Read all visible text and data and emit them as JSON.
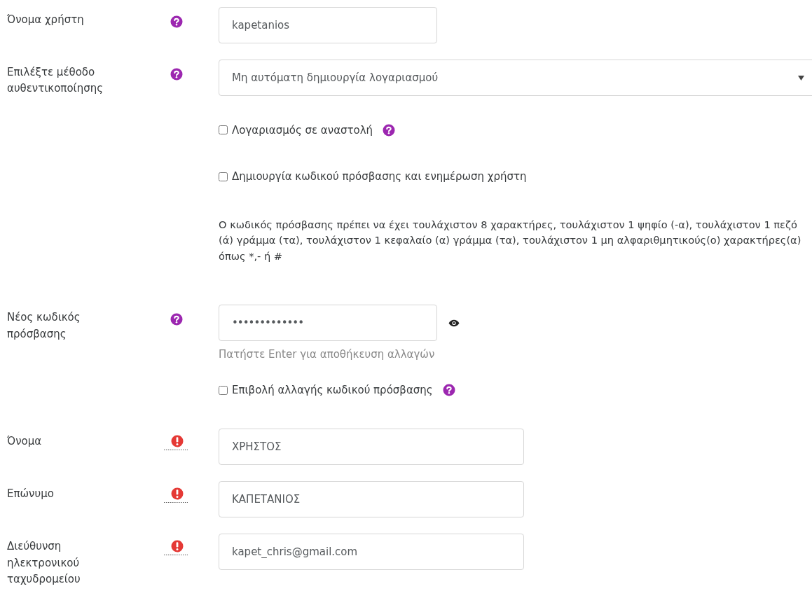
{
  "rows": [
    {
      "kind": "text",
      "label": "Όνομα χρήστη",
      "help": true,
      "required": false,
      "value": "kapetanios",
      "wide": false
    },
    {
      "kind": "select",
      "label": "Επιλέξτε μέθοδο αυθεντικοποίησης",
      "help": true,
      "required": false,
      "value": "Μη αυτόματη δημιουργία λογαριασμού"
    },
    {
      "kind": "checkbox",
      "text": "Λογαριασμός σε αναστολή",
      "checked": false,
      "help": true
    },
    {
      "kind": "checkbox",
      "text": "Δημιουργία κωδικού πρόσβασης και ενημέρωση χρήστη",
      "checked": false,
      "help": false
    },
    {
      "kind": "paragraph",
      "text": "Ο κωδικός πρόσβασης πρέπει να έχει τουλάχιστον 8 χαρακτήρες, τουλάχιστον 1 ψηφίο (-α), τουλάχιστον 1 πεζό (ά) γράμμα (τα), τουλάχιστον 1 κεφαλαίο (α) γράμμα (τα), τουλάχιστον 1 μη αλφαριθμητικούς(ο) χαρακτήρες(α) όπως *,- ή #"
    },
    {
      "kind": "password",
      "label": "Νέος κωδικός πρόσβασης",
      "help": true,
      "required": false,
      "value": "•••••••••••••",
      "hint": "Πατήστε Enter για αποθήκευση αλλαγών"
    },
    {
      "kind": "checkbox",
      "text": "Επιβολή αλλαγής κωδικού πρόσβασης",
      "checked": false,
      "help": true
    },
    {
      "kind": "text",
      "label": "Όνομα",
      "help": false,
      "required": true,
      "value": "ΧΡΗΣΤΟΣ",
      "wide": true
    },
    {
      "kind": "text",
      "label": "Επώνυμο",
      "help": false,
      "required": true,
      "value": "ΚΑΠΕΤΑΝΙΟΣ",
      "wide": true
    },
    {
      "kind": "text",
      "label": "Διεύθυνση ηλεκτρονικού ταχυδρομείου",
      "help": false,
      "required": true,
      "value": "kapet_chris@gmail.com",
      "wide": true
    }
  ]
}
